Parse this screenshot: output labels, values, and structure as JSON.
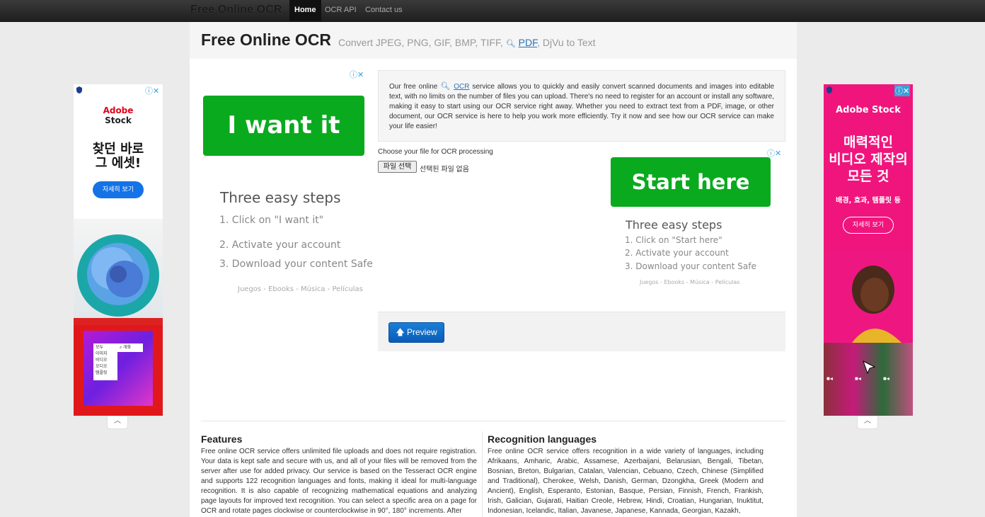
{
  "nav": {
    "brand": "Free Online OCR",
    "links": [
      "Home",
      "OCR API",
      "Contact us"
    ]
  },
  "header": {
    "title": "Free Online OCR",
    "subtitle_pre": "Convert JPEG, PNG, GIF, BMP, TIFF,",
    "subtitle_link": "PDF",
    "subtitle_post": ", DjVu to Text"
  },
  "ad_left_main": {
    "button": "I want it",
    "steps_title": "Three easy steps",
    "steps": [
      "1. Click on \"I want it\"",
      "2. Activate your account",
      "3. Download your content Safe"
    ],
    "footer": "Juegos - Ebooks - Música - Películas"
  },
  "intro": {
    "pre": "Our free online",
    "link": "OCR",
    "post": "service allows you to quickly and easily convert scanned documents and images into editable text, with no limits on the number of files you can upload. There's no need to register for an account or install any software, making it easy to start using our OCR service right away. Whether you need to extract text from a PDF, image, or other document, our OCR service is here to help you work more efficiently. Try it now and see how our OCR service can make your life easier!"
  },
  "upload": {
    "label": "Choose your file for OCR processing",
    "button": "파일 선택",
    "status": "선택된 파일 없음"
  },
  "ad_right_main": {
    "button": "Start here",
    "steps_title": "Three easy steps",
    "steps": [
      "1. Click on \"Start here\"",
      "2. Activate your account",
      "3. Download your content Safe"
    ],
    "footer": "Juegos - Ebooks - Música - Películas"
  },
  "preview": {
    "label": "Preview"
  },
  "features": {
    "title": "Features",
    "text": "Free online OCR service offers unlimited file uploads and does not require registration. Your data is kept safe and secure with us, and all of your files will be removed from the server after use for added privacy. Our service is based on the Tesseract OCR engine and supports 122 recognition languages and fonts, making it ideal for multi-language recognition. It is also capable of recognizing mathematical equations and analyzing page layouts for improved text recognition. You can select a specific area on a page for OCR and rotate pages clockwise or counterclockwise in 90°, 180° increments. After"
  },
  "languages": {
    "title": "Recognition languages",
    "text": "Free online OCR service offers recognition in a wide variety of languages, including Afrikaans, Amharic, Arabic, Assamese, Azerbaijani, Belarusian, Bengali, Tibetan, Bosnian, Breton, Bulgarian, Catalan, Valencian, Cebuano, Czech, Chinese (Simplified and Traditional), Cherokee, Welsh, Danish, German, Dzongkha, Greek (Modern and Ancient), English, Esperanto, Estonian, Basque, Persian, Finnish, French, Frankish, Irish, Galician, Gujarati, Haitian Creole, Hebrew, Hindi, Croatian, Hungarian, Inuktitut, Indonesian, Icelandic, Italian, Javanese, Japanese, Kannada, Georgian, Kazakh,"
  },
  "side_ad_left": {
    "brand_line1": "Adobe",
    "brand_line2": "Stock",
    "headline_line1": "찾던 바로",
    "headline_line2": "그 에셋!",
    "button": "자세히 보기",
    "menu": [
      "모두",
      "이미지",
      "비디오",
      "오디오",
      "템플릿"
    ],
    "search": "개화"
  },
  "side_ad_right": {
    "brand": "Adobe Stock",
    "headline_line1": "매력적인",
    "headline_line2": "비디오 제작의",
    "headline_line3": "모든 것",
    "sub": "배경, 효과, 템플릿 등",
    "button": "자세히 보기"
  },
  "colors": {
    "brand_green": "#0aaa1e",
    "primary_blue": "#0a5cb6",
    "adobe_red": "#e3001b",
    "magenta": "#f0157d"
  }
}
